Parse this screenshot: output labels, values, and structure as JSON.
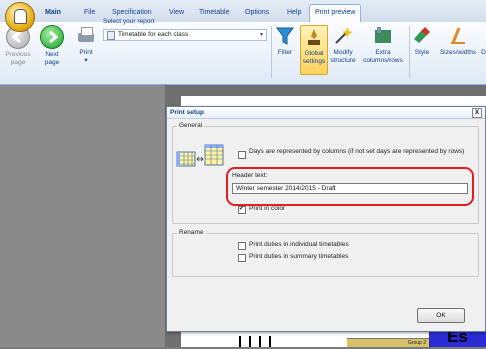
{
  "tabs": [
    {
      "label": "Main",
      "active": false,
      "bold": true
    },
    {
      "label": "File",
      "active": false
    },
    {
      "label": "Specification",
      "active": false
    },
    {
      "label": "View",
      "active": false
    },
    {
      "label": "Timetable",
      "active": false
    },
    {
      "label": "Options",
      "active": false
    },
    {
      "label": "Help",
      "active": false
    },
    {
      "label": "Print preview",
      "active": true
    }
  ],
  "ribbon": {
    "previous_page": {
      "line1": "Previous",
      "line2": "page"
    },
    "next_page": {
      "line1": "Next",
      "line2": "page"
    },
    "print": {
      "line1": "Print"
    },
    "select_report_label": "Select your report",
    "report_value": "Timetable for each class",
    "filter": {
      "line1": "Filter"
    },
    "global_settings": {
      "line1": "Global",
      "line2": "settings"
    },
    "modify_structure": {
      "line1": "Modify",
      "line2": "structure"
    },
    "extra_columns": {
      "line1": "Extra",
      "line2": "columns/rows"
    },
    "style": {
      "line1": "Style"
    },
    "sizes_widths": {
      "line1": "Sizes/widths"
    },
    "cut_letter": "D"
  },
  "dialog": {
    "title": "Print setup",
    "close": "X",
    "general_label": "General",
    "days_by_columns": {
      "label": "Days are represented by columns (if not set days are represented by rows)",
      "checked": false
    },
    "header_text_label": "Header text:",
    "header_text_value": "Winter semester 2014/2015 - Draft",
    "print_in_color": {
      "label": "Print in color",
      "checked": true
    },
    "rename_label": "Rename",
    "print_duties_individual": {
      "label": "Print duties in individual timetables",
      "checked": false
    },
    "print_duties_summary": {
      "label": "Print duties in summary timetables",
      "checked": false
    },
    "ok": "OK"
  },
  "background": {
    "group_label": "Group 2",
    "big_text": "Es"
  },
  "colors": {
    "accent": "#15428b",
    "highlight": "#e02020",
    "ribbon_blue": "#8db2e3"
  }
}
